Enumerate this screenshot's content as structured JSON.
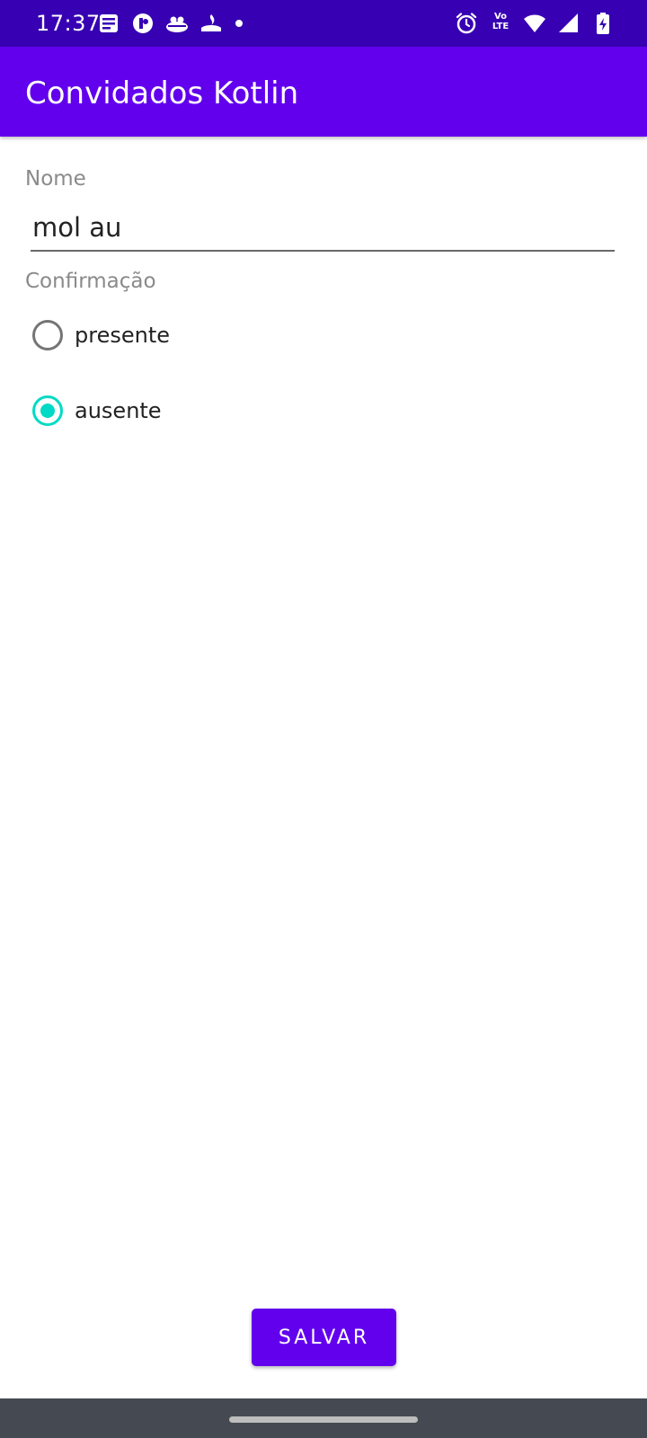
{
  "status_bar": {
    "time": "17:37",
    "left_icons": [
      "news-icon",
      "app-icon",
      "boat-icon",
      "santander-icon",
      "dot-icon"
    ],
    "right_icons": [
      "alarm-icon",
      "volte-icon",
      "wifi-icon",
      "signal-icon",
      "battery-charging-icon"
    ],
    "volte_top": "Vo",
    "volte_bottom": "LTE",
    "background_color": "#3700b3"
  },
  "app_bar": {
    "title": "Convidados Kotlin",
    "background_color": "#6200ee"
  },
  "form": {
    "name_label": "Nome",
    "name_value": "mol au",
    "confirmation_label": "Confirmação",
    "options": [
      {
        "label": "presente",
        "checked": false
      },
      {
        "label": "ausente",
        "checked": true
      }
    ],
    "accent_color": "#03dac5"
  },
  "actions": {
    "save_label": "SALVAR"
  }
}
